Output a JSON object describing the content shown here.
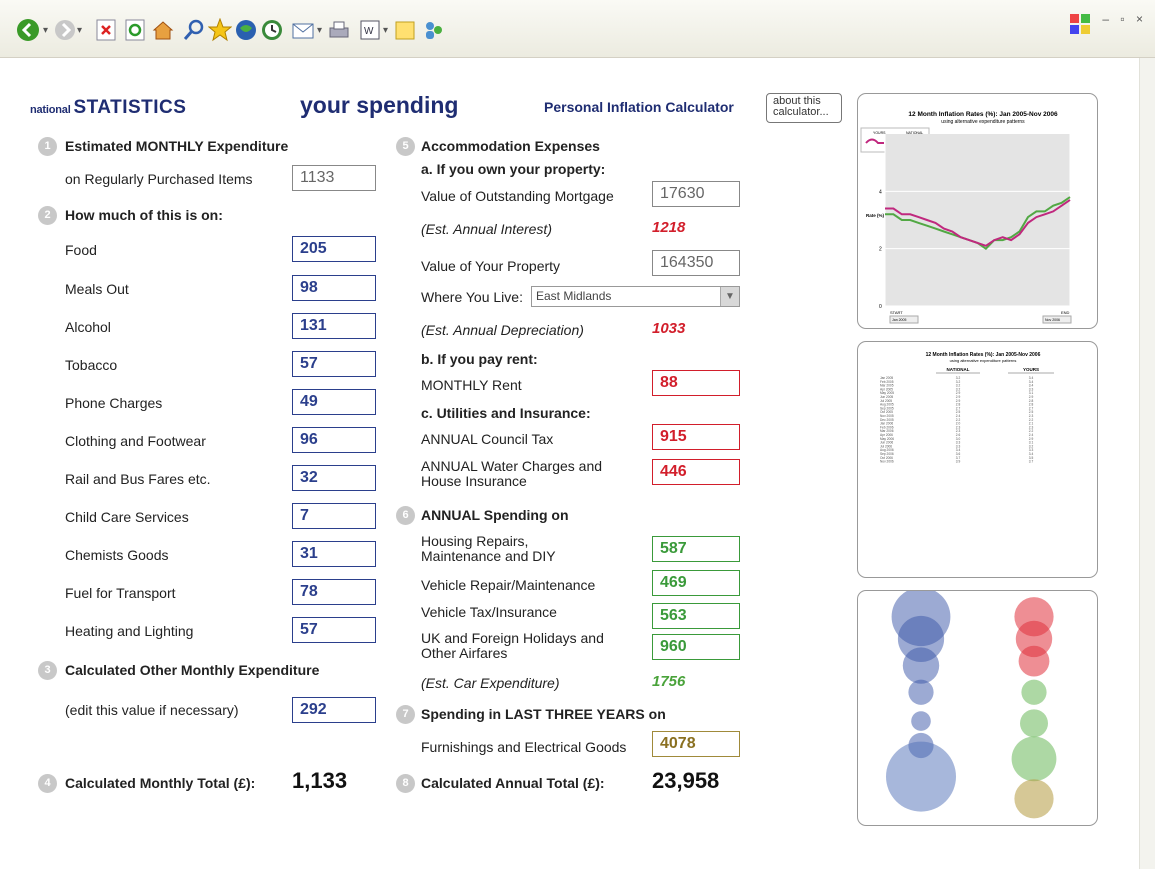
{
  "brand": {
    "prefix": "national",
    "name": "STATISTICS"
  },
  "title": "your spending",
  "subtitle": "Personal Inflation Calculator",
  "about_label": "about this calculator...",
  "toolbar": [
    "back-icon",
    "forward-icon",
    "stop-icon",
    "refresh-icon",
    "home-icon",
    "search-icon",
    "favorites-icon",
    "media-icon",
    "history-icon",
    "mail-icon",
    "print-icon",
    "edit-icon",
    "folder-icon",
    "messenger-icon"
  ],
  "s1": {
    "num": "1",
    "heading": "Estimated MONTHLY Expenditure",
    "label": "on Regularly Purchased Items",
    "value": "1133"
  },
  "s2": {
    "num": "2",
    "heading": "How much of this is on:",
    "items": [
      {
        "label": "Food",
        "value": "205"
      },
      {
        "label": "Meals Out",
        "value": "98"
      },
      {
        "label": "Alcohol",
        "value": "131"
      },
      {
        "label": "Tobacco",
        "value": "57"
      },
      {
        "label": "Phone Charges",
        "value": "49"
      },
      {
        "label": "Clothing and Footwear",
        "value": "96"
      },
      {
        "label": "Rail and Bus Fares etc.",
        "value": "32"
      },
      {
        "label": "Child Care Services",
        "value": "7"
      },
      {
        "label": "Chemists Goods",
        "value": "31"
      },
      {
        "label": "Fuel for Transport",
        "value": "78"
      },
      {
        "label": "Heating and Lighting",
        "value": "57"
      }
    ]
  },
  "s3": {
    "num": "3",
    "heading": "Calculated Other Monthly Expenditure",
    "label": "(edit this value if necessary)",
    "value": "292"
  },
  "s4": {
    "num": "4",
    "label": "Calculated Monthly Total (£):",
    "value": "1,133"
  },
  "s5": {
    "num": "5",
    "heading": "Accommodation Expenses",
    "a": "a. If you own your property:",
    "mortgage_label": "Value of Outstanding Mortgage",
    "mortgage": "17630",
    "interest_label": "(Est. Annual Interest)",
    "interest": "1218",
    "property_label": "Value of Your Property",
    "property": "164350",
    "where_label": "Where You Live:",
    "where": "East Midlands",
    "dep_label": "(Est. Annual Depreciation)",
    "dep": "1033",
    "b": "b. If you pay rent:",
    "rent_label": "MONTHLY Rent",
    "rent": "88",
    "c": "c. Utilities and Insurance:",
    "council_label": "ANNUAL Council Tax",
    "council": "915",
    "water_label": "ANNUAL Water Charges and House Insurance",
    "water": "446"
  },
  "s6": {
    "num": "6",
    "heading": "ANNUAL Spending on",
    "repairs_label": "Housing Repairs, Maintenance and DIY",
    "repairs": "587",
    "vehicle_label": "Vehicle Repair/Maintenance",
    "vehicle": "469",
    "tax_label": "Vehicle Tax/Insurance",
    "tax": "563",
    "hol_label": "UK and Foreign Holidays and Other Airfares",
    "hol": "960",
    "car_label": "(Est. Car Expenditure)",
    "car": "1756"
  },
  "s7": {
    "num": "7",
    "heading": "Spending in LAST THREE YEARS on",
    "label": "Furnishings and Electrical Goods",
    "value": "4078"
  },
  "s8": {
    "num": "8",
    "label": "Calculated Annual Total (£):",
    "value": "23,958"
  },
  "chart_data": {
    "type": "line",
    "title": "12 Month Inflation Rates (%): Jan 2005-Nov 2006",
    "subtitle": "using alternative expenditure patterns",
    "ylabel": "Rate (%)",
    "ylim": [
      0,
      6
    ],
    "yticks": [
      "0",
      "2",
      "4"
    ],
    "legend": [
      "YOURS",
      "NATIONAL"
    ],
    "xstart": "START",
    "xend": "END",
    "start_sel": "Jan 2005",
    "end_sel": "Nov 2006",
    "series": [
      {
        "name": "YOURS",
        "color": "#c0287e",
        "values": [
          3.4,
          3.4,
          3.2,
          3.2,
          3.1,
          3.0,
          2.9,
          2.7,
          2.6,
          2.4,
          2.3,
          2.2,
          2.1,
          2.3,
          2.4,
          2.3,
          2.5,
          2.9,
          3.1,
          3.2,
          3.3,
          3.5,
          3.7
        ]
      },
      {
        "name": "NATIONAL",
        "color": "#52a844",
        "values": [
          3.2,
          3.2,
          3.0,
          3.0,
          2.9,
          2.8,
          2.7,
          2.6,
          2.5,
          2.4,
          2.3,
          2.2,
          2.0,
          2.3,
          2.3,
          2.4,
          2.6,
          3.1,
          3.3,
          3.3,
          3.5,
          3.6,
          3.8
        ]
      }
    ]
  },
  "table": {
    "title": "12 Month Inflation Rates (%): Jan 2005-Nov 2006",
    "subtitle": "using alternative expenditure patterns",
    "cols": [
      "NATIONAL",
      "YOURS"
    ],
    "rows": [
      [
        "Jan 2005",
        "3.2",
        "3.4"
      ],
      [
        "Feb 2005",
        "3.2",
        "3.4"
      ],
      [
        "Mar 2005",
        "3.2",
        "3.4"
      ],
      [
        "Apr 2005",
        "3.2",
        "3.3"
      ],
      [
        "May 2005",
        "2.9",
        "3.1"
      ],
      [
        "Jun 2005",
        "2.9",
        "2.9"
      ],
      [
        "Jul 2005",
        "2.9",
        "2.8"
      ],
      [
        "Aug 2005",
        "2.8",
        "2.8"
      ],
      [
        "Sep 2005",
        "2.7",
        "2.7"
      ],
      [
        "Oct 2005",
        "2.5",
        "2.5"
      ],
      [
        "Nov 2005",
        "2.4",
        "2.3"
      ],
      [
        "Dec 2005",
        "2.2",
        "2.2"
      ],
      [
        "Jan 2006",
        "2.0",
        "2.1"
      ],
      [
        "Feb 2006",
        "2.3",
        "2.3"
      ],
      [
        "Mar 2006",
        "2.3",
        "2.2"
      ],
      [
        "Apr 2006",
        "2.6",
        "2.4"
      ],
      [
        "May 2006",
        "3.0",
        "2.9"
      ],
      [
        "Jun 2006",
        "3.3",
        "3.1"
      ],
      [
        "Jul 2006",
        "3.3",
        "3.2"
      ],
      [
        "Aug 2006",
        "3.4",
        "3.3"
      ],
      [
        "Sep 2006",
        "3.6",
        "3.4"
      ],
      [
        "Oct 2006",
        "3.7",
        "3.5"
      ],
      [
        "Nov 2006",
        "3.9",
        "3.7"
      ]
    ]
  },
  "bubbles": {
    "national": [
      {
        "r": 0.42,
        "y": 0.08
      },
      {
        "r": 0.33,
        "y": 0.18
      },
      {
        "r": 0.26,
        "y": 0.3
      },
      {
        "r": 0.18,
        "y": 0.42
      },
      {
        "r": 0.14,
        "y": 0.55
      },
      {
        "r": 0.18,
        "y": 0.66
      },
      {
        "r": 0.5,
        "y": 0.8
      }
    ],
    "yours": [
      {
        "r": 0.28,
        "y": 0.08
      },
      {
        "r": 0.26,
        "y": 0.18
      },
      {
        "r": 0.22,
        "y": 0.28
      },
      {
        "r": 0.18,
        "y": 0.42
      },
      {
        "r": 0.2,
        "y": 0.56
      },
      {
        "r": 0.32,
        "y": 0.72
      },
      {
        "r": 0.28,
        "y": 0.9
      }
    ]
  }
}
